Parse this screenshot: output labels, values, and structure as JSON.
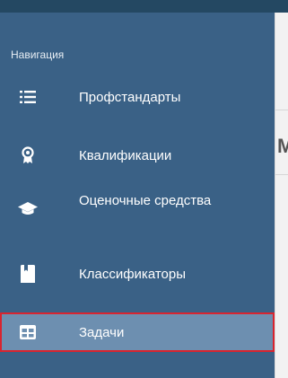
{
  "navigation": {
    "title": "Навигация",
    "items": [
      {
        "label": "Профстандарты",
        "icon": "list-icon"
      },
      {
        "label": "Квалификации",
        "icon": "award-icon"
      },
      {
        "label": "Оценочные средства",
        "icon": "graduation-cap-icon"
      },
      {
        "label": "Классификаторы",
        "icon": "bookmark-icon"
      },
      {
        "label": "Задачи",
        "icon": "table-icon",
        "active": true
      }
    ]
  },
  "colors": {
    "panel": "#3a6186",
    "active": "#6d8fb0",
    "highlight_border": "#d8242f"
  }
}
